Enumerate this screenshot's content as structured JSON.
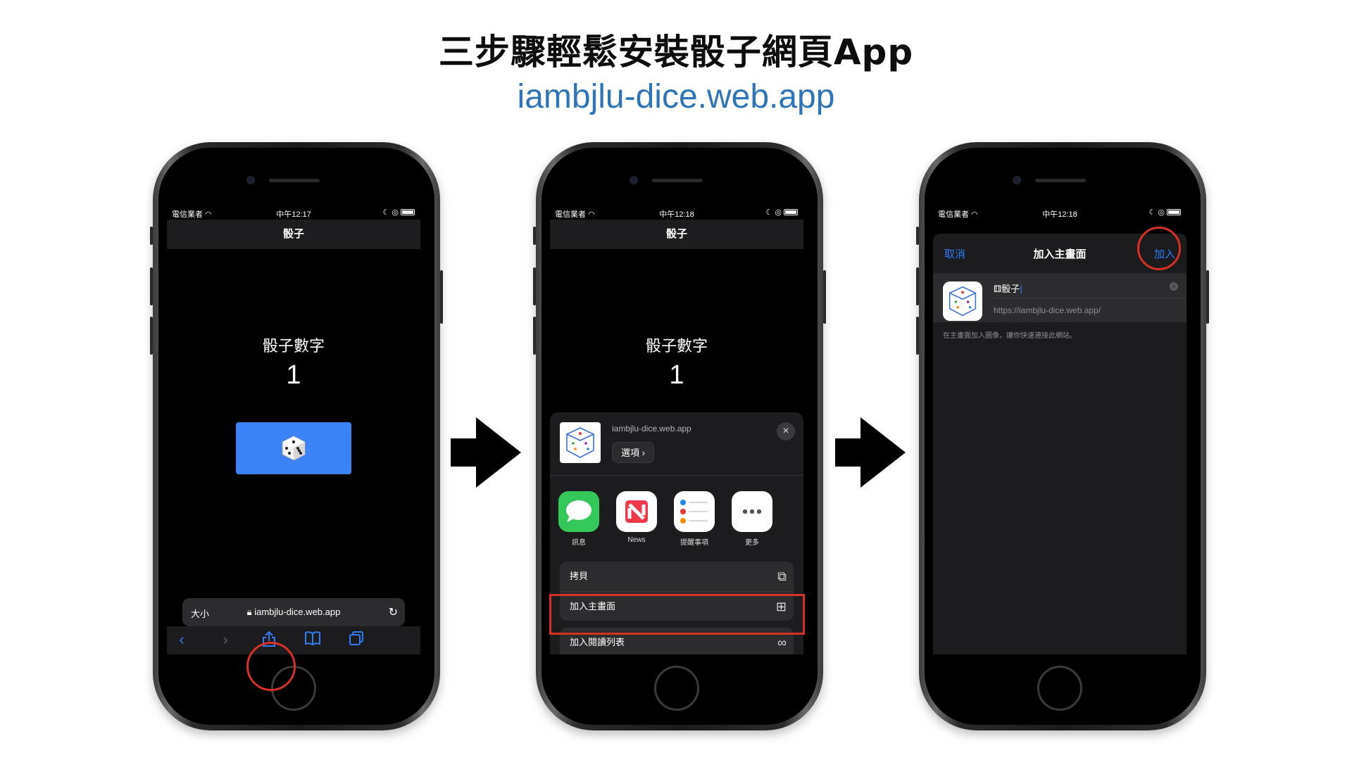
{
  "header": {
    "title": "三步驟輕鬆安裝骰子網頁App",
    "subtitle": "iambjlu-dice.web.app"
  },
  "step1": {
    "status": {
      "carrier": "電信業者",
      "time": "中午12:17"
    },
    "nav_title": "骰子",
    "dice_label": "骰子數字",
    "dice_number": "1",
    "url_aa": "大小",
    "url_text": "iambjlu-dice.web.app",
    "toolbar_icons": [
      "back-icon",
      "forward-icon",
      "share-icon",
      "bookmarks-icon",
      "tabs-icon"
    ]
  },
  "step2": {
    "status": {
      "carrier": "電信業者",
      "time": "中午12:18"
    },
    "nav_title": "骰子",
    "dice_label": "骰子數字",
    "dice_number": "1",
    "sheet": {
      "site": "iambjlu-dice.web.app",
      "options_label": "選項",
      "apps": [
        {
          "name": "訊息",
          "color": "#34c759"
        },
        {
          "name": "News",
          "color": "#ffffff"
        },
        {
          "name": "提醒事項",
          "color": "#ffffff"
        },
        {
          "name": "更多",
          "color": "#ffffff"
        }
      ],
      "actions": [
        "拷貝",
        "加入主畫面",
        "加入閱讀列表"
      ]
    }
  },
  "step3": {
    "status": {
      "carrier": "電信業者",
      "time": "中午12:18"
    },
    "cancel": "取消",
    "title": "加入主畫面",
    "add": "加入",
    "app_name": "骰子",
    "url": "https://iambjlu-dice.web.app/",
    "hint": "在主畫面加入圖像，讓你快速連接此網站。"
  },
  "colors": {
    "accent": "#2f7cf6",
    "highlight": "#d93025",
    "subtitle": "#2e74b9",
    "button": "#3b82f6"
  }
}
